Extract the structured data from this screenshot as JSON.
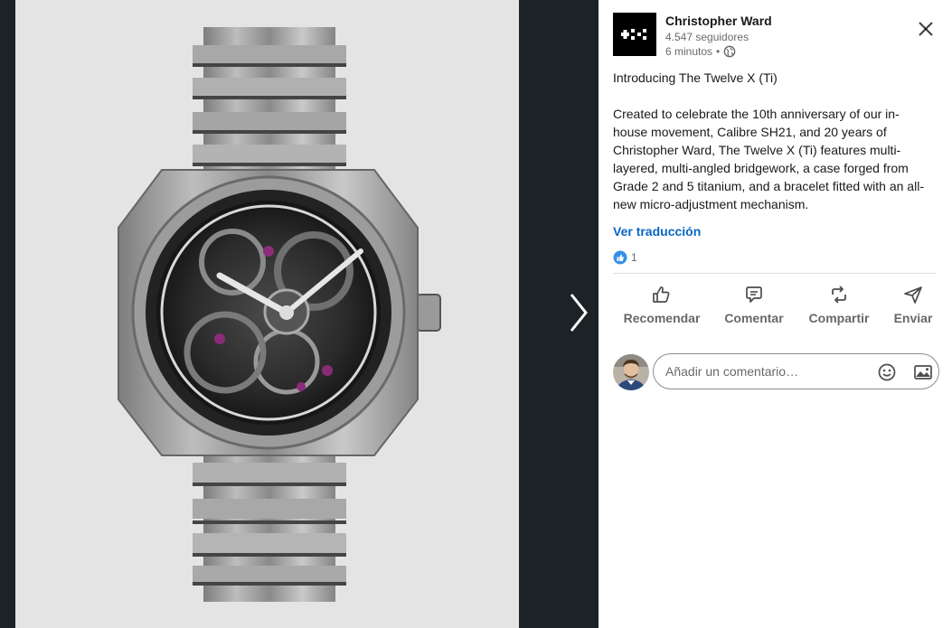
{
  "post": {
    "author": "Christopher Ward",
    "followers": "4.547 seguidores",
    "time": "6 minutos",
    "separator": "•",
    "visibility_icon": "globe-icon",
    "title": "Introducing The Twelve X (Ti)",
    "body": "Created to celebrate the 10th anniversary of our in-house movement, Calibre SH21, and 20 years of Christopher Ward, The Twelve X (Ti) features multi-layered, multi-angled bridgework, a case forged from Grade 2 and 5 titanium, and a bracelet fitted with an all-new micro-adjustment mechanism.",
    "see_translation": "Ver traducción",
    "reaction_count": "1"
  },
  "actions": [
    {
      "label": "Recomendar",
      "icon": "thumbs-up-icon"
    },
    {
      "label": "Comentar",
      "icon": "comment-icon"
    },
    {
      "label": "Compartir",
      "icon": "repost-icon"
    },
    {
      "label": "Enviar",
      "icon": "send-icon"
    }
  ],
  "comment": {
    "placeholder": "Añadir un comentario…",
    "emoji_icon": "emoji-icon",
    "image_icon": "image-icon"
  },
  "colors": {
    "accent": "#0a66c2",
    "dark_background": "#1d2226",
    "panel_background": "#ffffff"
  }
}
